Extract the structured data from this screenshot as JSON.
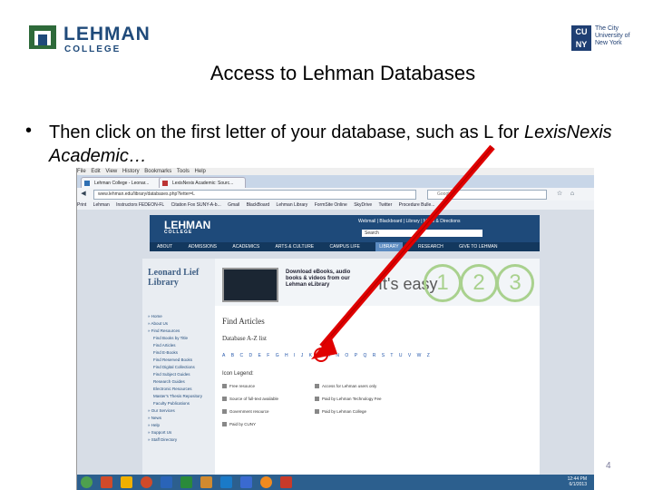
{
  "slide": {
    "title": "Access to Lehman Databases",
    "bullet_main": "Then click on the first letter of your database, such as L for ",
    "bullet_italic": "LexisNexis Academic…",
    "page_number": "4",
    "logo_left_1": "LEHMAN",
    "logo_left_2": "COLLEGE",
    "logo_right_box": "CU NY",
    "logo_right_text": "The City University of New York"
  },
  "browser": {
    "menu": [
      "File",
      "Edit",
      "View",
      "History",
      "Bookmarks",
      "Tools",
      "Help"
    ],
    "tabs": [
      {
        "label": "Lehman College - Leonar..."
      },
      {
        "label": "LexisNexis Academic: Sourc..."
      }
    ],
    "url": "www.lehman.edu/library/databases.php?letter=L",
    "search_placeholder": "Google",
    "bookmarks": [
      "Print",
      "Lehman",
      "Instructors FEDEON-FL",
      "Citation Fox SUNY-A-b...",
      "Gmail",
      "BlackBoard",
      "Lehman Library",
      "FormSite Online",
      "SkyDrive",
      "Twitter",
      "Procedure Bulle..."
    ]
  },
  "site": {
    "logo": "LEHMAN",
    "logo_sub": "COLLEGE",
    "top_links": "Webmail | Blackboard | Library | Maps & Directions",
    "search_value": "Search",
    "nav": [
      "ABOUT",
      "ADMISSIONS",
      "ACADEMICS",
      "ARTS & CULTURE",
      "CAMPUS LIFE",
      "LIBRARY",
      "RESEARCH",
      "GIVE TO LEHMAN"
    ],
    "library_title": "Leonard Lief Library",
    "sidebar_items": [
      "» Home",
      "» About Us",
      "» Find Resources",
      "Find Books by Title",
      "Find Articles",
      "Find E-Books",
      "Find Reserved Books",
      "Find Digital Collections",
      "Find Subject Guides",
      "Research Guides",
      "Electronic Resources",
      "Master's Thesis Repository",
      "Faculty Publications",
      "» Our Services",
      "» News",
      "» Help",
      "» Support Us",
      "» Staff Directory"
    ],
    "banner_text": "Download eBooks, audio books & videos from our Lehman eLibrary",
    "banner_easy": "It's easy",
    "banner_steps": [
      "1",
      "2",
      "3"
    ],
    "find_articles": "Find Articles",
    "az_heading": "Database A-Z list",
    "letters": [
      "A",
      "B",
      "C",
      "D",
      "E",
      "F",
      "G",
      "H",
      "I",
      "J",
      "K",
      "L",
      "M",
      "N",
      "O",
      "P",
      "Q",
      "R",
      "S",
      "T",
      "U",
      "V",
      "W",
      "Z"
    ],
    "icon_legend_title": "Icon Legend:",
    "legend": [
      "Free resource",
      "Access for Lehman users only",
      "Source of full-text available",
      "Paid by Lehman Technology Fee",
      "Government resource",
      "Paid by Lehman College",
      "Paid by CUNY"
    ],
    "clock_time": "12:44 PM",
    "clock_date": "6/1/2013"
  },
  "colors": {
    "lehman_blue": "#1e4a7a",
    "arrow_red": "#e00000"
  }
}
